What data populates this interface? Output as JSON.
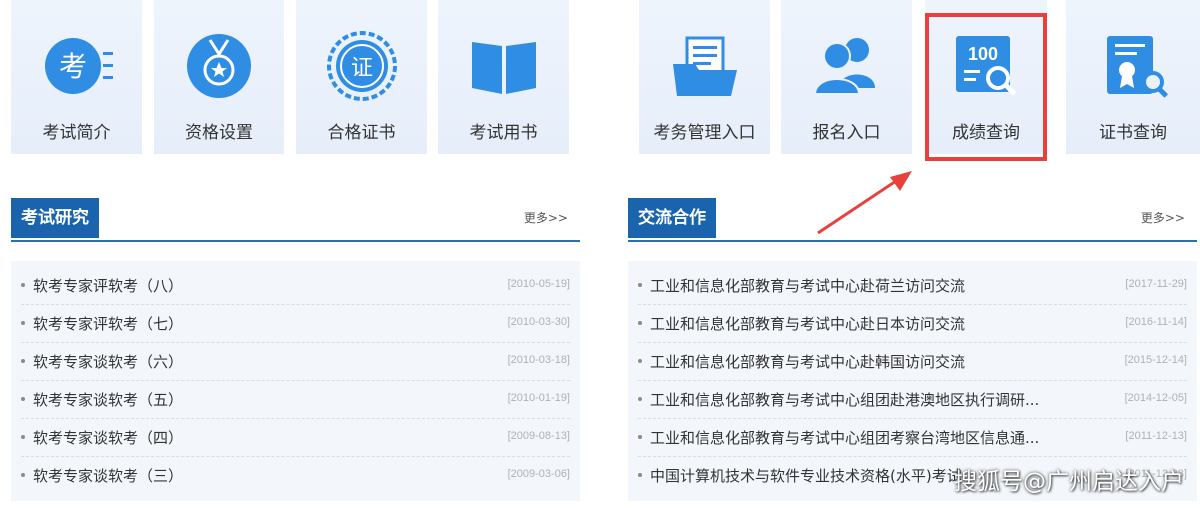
{
  "tiles": [
    {
      "label": "考试简介",
      "icon": "exam-icon",
      "badge": "考"
    },
    {
      "label": "资格设置",
      "icon": "medal-icon"
    },
    {
      "label": "合格证书",
      "icon": "certificate-seal-icon",
      "badge": "证"
    },
    {
      "label": "考试用书",
      "icon": "book-icon"
    },
    {
      "label": "考务管理入口",
      "icon": "folder-icon"
    },
    {
      "label": "报名入口",
      "icon": "users-icon"
    },
    {
      "label": "成绩查询",
      "icon": "score-search-icon",
      "badge": "100"
    },
    {
      "label": "证书查询",
      "icon": "certificate-search-icon"
    }
  ],
  "research": {
    "title": "考试研究",
    "more": "更多>>",
    "items": [
      {
        "title": "软考专家评软考（八）",
        "date": "[2010-05-19]"
      },
      {
        "title": "软考专家评软考（七）",
        "date": "[2010-03-30]"
      },
      {
        "title": "软考专家谈软考（六）",
        "date": "[2010-03-18]"
      },
      {
        "title": "软考专家谈软考（五）",
        "date": "[2010-01-19]"
      },
      {
        "title": "软考专家谈软考（四）",
        "date": "[2009-08-13]"
      },
      {
        "title": "软考专家谈软考（三）",
        "date": "[2009-03-06]"
      }
    ]
  },
  "cooperation": {
    "title": "交流合作",
    "more": "更多>>",
    "items": [
      {
        "title": "工业和信息化部教育与考试中心赴荷兰访问交流",
        "date": "[2017-11-29]"
      },
      {
        "title": "工业和信息化部教育与考试中心赴日本访问交流",
        "date": "[2016-11-14]"
      },
      {
        "title": "工业和信息化部教育与考试中心赴韩国访问交流",
        "date": "[2015-12-14]"
      },
      {
        "title": "工业和信息化部教育与考试中心组团赴港澳地区执行调研...",
        "date": "[2014-12-05]"
      },
      {
        "title": "工业和信息化部教育与考试中心组团考察台湾地区信息通...",
        "date": "[2011-12-13]"
      },
      {
        "title": "中国计算机技术与软件专业技术资格(水平)考试...",
        "date": "[2011-12-08]"
      }
    ]
  },
  "watermark": "搜狐号@广州启达入户",
  "colors": {
    "brand_blue": "#1a64ad",
    "icon_blue": "#2f8de4",
    "highlight_red": "#e8413c"
  }
}
